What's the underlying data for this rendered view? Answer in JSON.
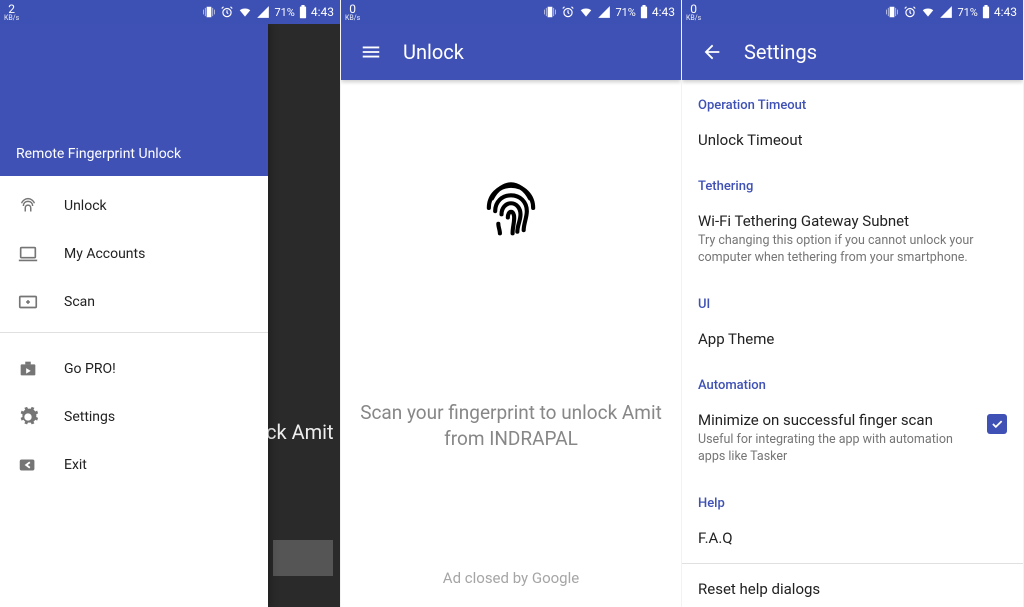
{
  "status": {
    "speed_left_1": "2",
    "speed_left_2": "0",
    "speed_left_3": "0",
    "speed_unit": "KB/s",
    "battery": "71%",
    "clock": "4:43"
  },
  "drawer": {
    "header": "Remote Fingerprint Unlock",
    "items": [
      {
        "label": "Unlock",
        "icon": "fingerprint"
      },
      {
        "label": "My Accounts",
        "icon": "laptop"
      },
      {
        "label": "Scan",
        "icon": "scan"
      }
    ],
    "items2": [
      {
        "label": "Go PRO!",
        "icon": "pro"
      },
      {
        "label": "Settings",
        "icon": "gear"
      },
      {
        "label": "Exit",
        "icon": "exit"
      }
    ],
    "bg_text": "ck Amit"
  },
  "unlock": {
    "title": "Unlock",
    "prompt": "Scan your fingerprint to unlock Amit from INDRAPAL",
    "ad_text": "Ad closed by Google"
  },
  "settings": {
    "title": "Settings",
    "sections": {
      "op_timeout": {
        "header": "Operation Timeout",
        "item": "Unlock Timeout"
      },
      "tethering": {
        "header": "Tethering",
        "item": "Wi-Fi Tethering Gateway Subnet",
        "sub": "Try changing this option if you cannot unlock your computer when tethering from your smartphone."
      },
      "ui": {
        "header": "UI",
        "item": "App Theme"
      },
      "automation": {
        "header": "Automation",
        "item": "Minimize on successful finger scan",
        "sub": "Useful for integrating the app with automation apps like Tasker"
      },
      "help": {
        "header": "Help",
        "item": "F.A.Q",
        "item2": "Reset help dialogs"
      }
    }
  }
}
